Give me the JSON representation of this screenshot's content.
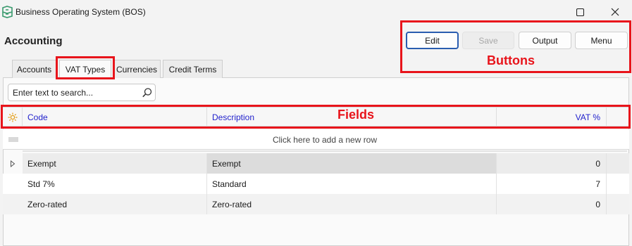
{
  "window": {
    "title": "Business Operating System (BOS)",
    "app_icon": "bos-logo-icon",
    "controls": {
      "maximize_icon": "maximize-icon",
      "close_icon": "close-icon"
    }
  },
  "section": {
    "title": "Accounting"
  },
  "toolbar": {
    "edit_label": "Edit",
    "save_label": "Save",
    "output_label": "Output",
    "menu_label": "Menu"
  },
  "tabs": [
    {
      "label": "Accounts",
      "active": false
    },
    {
      "label": "VAT Types",
      "active": true
    },
    {
      "label": "Currencies",
      "active": false
    },
    {
      "label": "Credit Terms",
      "active": false
    }
  ],
  "search": {
    "placeholder": "Enter text to search...",
    "value": "",
    "icon": "search-icon"
  },
  "grid": {
    "settings_icon": "sun-settings-icon",
    "columns": [
      "Code",
      "Description",
      "VAT %"
    ],
    "new_row_text": "Click here to add a new row",
    "rows": [
      {
        "code": "Exempt",
        "description": "Exempt",
        "vat": "0",
        "selected": true
      },
      {
        "code": "Std 7%",
        "description": "Standard",
        "vat": "7",
        "selected": false
      },
      {
        "code": "Zero-rated",
        "description": "Zero-rated",
        "vat": "0",
        "selected": false
      }
    ]
  },
  "annotations": {
    "buttons_label": "Buttons",
    "fields_label": "Fields",
    "color": "#e8141b"
  },
  "colors": {
    "header_text": "#2222cc",
    "edit_border": "#2a5db0",
    "app_icon": "#3a9a6e"
  }
}
